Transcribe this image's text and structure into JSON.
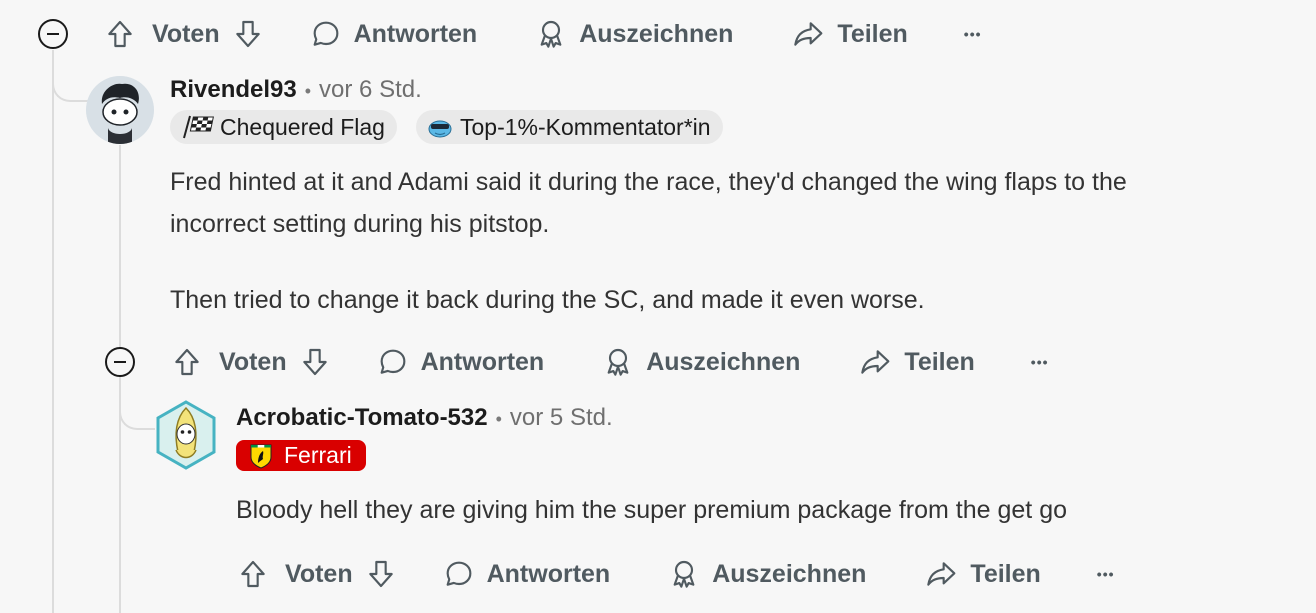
{
  "actions": {
    "vote_label": "Voten",
    "reply_label": "Antworten",
    "award_label": "Auszeichnen",
    "share_label": "Teilen",
    "more_label": "•••"
  },
  "comments": [
    {
      "username": "Rivendel93",
      "separator": "•",
      "time": "vor 6 Std.",
      "flairs": [
        "Chequered Flag",
        "Top-1%-Kommentator*in"
      ],
      "paragraphs": [
        "Fred hinted at it and Adami said it during the race, they'd changed the wing flaps to the",
        "incorrect setting during his pitstop.",
        "Then tried to change it back during the SC, and made it even worse."
      ]
    },
    {
      "username": "Acrobatic-Tomato-532",
      "separator": "•",
      "time": "vor 5 Std.",
      "flairs": [
        "Ferrari"
      ],
      "paragraphs": [
        "Bloody hell they are giving him the super premium package from the get go"
      ]
    }
  ],
  "colors": {
    "background": "#f7f7f7",
    "ferrari_flair": "#d90000",
    "flair_pill": "#e9e9e9",
    "thread_line": "#dcdcdc"
  }
}
